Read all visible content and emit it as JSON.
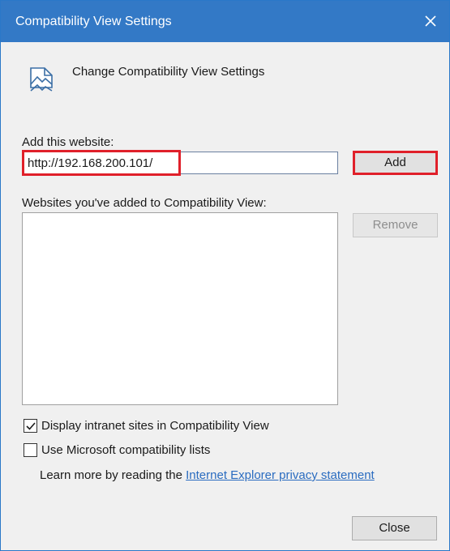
{
  "window": {
    "title": "Compatibility View Settings"
  },
  "header": {
    "text": "Change Compatibility View Settings",
    "icon": "compatibility-view-icon"
  },
  "add_section": {
    "label": "Add this website:",
    "url_value": "http://192.168.200.101/",
    "add_button": "Add",
    "highlight_color": "#e0202a"
  },
  "list_section": {
    "label": "Websites you've added to Compatibility View:",
    "items": [],
    "remove_button": "Remove"
  },
  "options": [
    {
      "label": "Display intranet sites in Compatibility View",
      "checked": true
    },
    {
      "label": "Use Microsoft compatibility lists",
      "checked": false
    }
  ],
  "learn_more": {
    "prefix": "Learn more by reading the ",
    "link_text": "Internet Explorer privacy statement"
  },
  "footer": {
    "close_button": "Close"
  },
  "colors": {
    "titlebar": "#3379c6",
    "link": "#2a6cc0",
    "annotation_red": "#e0202a"
  }
}
